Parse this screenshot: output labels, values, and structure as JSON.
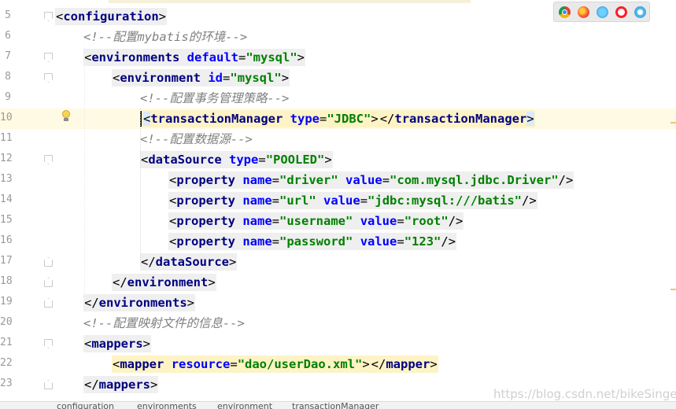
{
  "editor": {
    "current_line": 10,
    "lines": [
      {
        "n": "5",
        "kind": "open",
        "indent": 0,
        "tag": "configuration"
      },
      {
        "n": "6",
        "kind": "comment",
        "indent": 1,
        "text": "<!--配置mybatis的环境-->"
      },
      {
        "n": "7",
        "kind": "open",
        "indent": 1,
        "tag": "environments",
        "attrs": [
          {
            "name": "default",
            "value": "\"mysql\""
          }
        ]
      },
      {
        "n": "8",
        "kind": "open",
        "indent": 2,
        "tag": "environment",
        "attrs": [
          {
            "name": "id",
            "value": "\"mysql\""
          }
        ]
      },
      {
        "n": "9",
        "kind": "comment",
        "indent": 3,
        "text": "<!--配置事务管理策略-->"
      },
      {
        "n": "10",
        "kind": "element",
        "indent": 3,
        "tag": "transactionManager",
        "attrs": [
          {
            "name": "type",
            "value": "\"JDBC\""
          }
        ]
      },
      {
        "n": "11",
        "kind": "comment",
        "indent": 3,
        "text": "<!--配置数据源-->"
      },
      {
        "n": "12",
        "kind": "open",
        "indent": 3,
        "tag": "dataSource",
        "attrs": [
          {
            "name": "type",
            "value": "\"POOLED\""
          }
        ]
      },
      {
        "n": "13",
        "kind": "selfclose",
        "indent": 4,
        "tag": "property",
        "attrs": [
          {
            "name": "name",
            "value": "\"driver\""
          },
          {
            "name": "value",
            "value": "\"com.mysql.jdbc.Driver\""
          }
        ]
      },
      {
        "n": "14",
        "kind": "selfclose",
        "indent": 4,
        "tag": "property",
        "attrs": [
          {
            "name": "name",
            "value": "\"url\""
          },
          {
            "name": "value",
            "value": "\"jdbc:mysql:///batis\""
          }
        ]
      },
      {
        "n": "15",
        "kind": "selfclose",
        "indent": 4,
        "tag": "property",
        "attrs": [
          {
            "name": "name",
            "value": "\"username\""
          },
          {
            "name": "value",
            "value": "\"root\""
          }
        ]
      },
      {
        "n": "16",
        "kind": "selfclose",
        "indent": 4,
        "tag": "property",
        "attrs": [
          {
            "name": "name",
            "value": "\"password\""
          },
          {
            "name": "value",
            "value": "\"123\""
          }
        ]
      },
      {
        "n": "17",
        "kind": "close",
        "indent": 3,
        "tag": "dataSource"
      },
      {
        "n": "18",
        "kind": "close",
        "indent": 2,
        "tag": "environment"
      },
      {
        "n": "19",
        "kind": "close",
        "indent": 1,
        "tag": "environments"
      },
      {
        "n": "20",
        "kind": "comment",
        "indent": 1,
        "text": "<!--配置映射文件的信息-->"
      },
      {
        "n": "21",
        "kind": "open",
        "indent": 1,
        "tag": "mappers"
      },
      {
        "n": "22",
        "kind": "element",
        "indent": 2,
        "tag": "mapper",
        "attrs": [
          {
            "name": "resource",
            "value": "\"dao/userDao.xml\""
          }
        ]
      },
      {
        "n": "23",
        "kind": "close",
        "indent": 1,
        "tag": "mappers"
      }
    ]
  },
  "browser_icons": [
    "chrome-icon",
    "firefox-icon",
    "safari-icon",
    "opera-icon",
    "ie-icon"
  ],
  "breadcrumbs": [
    "configuration",
    "environments",
    "environment",
    "transactionManager"
  ],
  "watermark": "https://blog.csdn.net/bikeSinger",
  "colors": {
    "tag": "#000080",
    "attribute": "#0000ff",
    "value": "#008000",
    "comment": "#808080",
    "current_line": "#fffae3",
    "tag_highlight": "#fdf3c5"
  }
}
